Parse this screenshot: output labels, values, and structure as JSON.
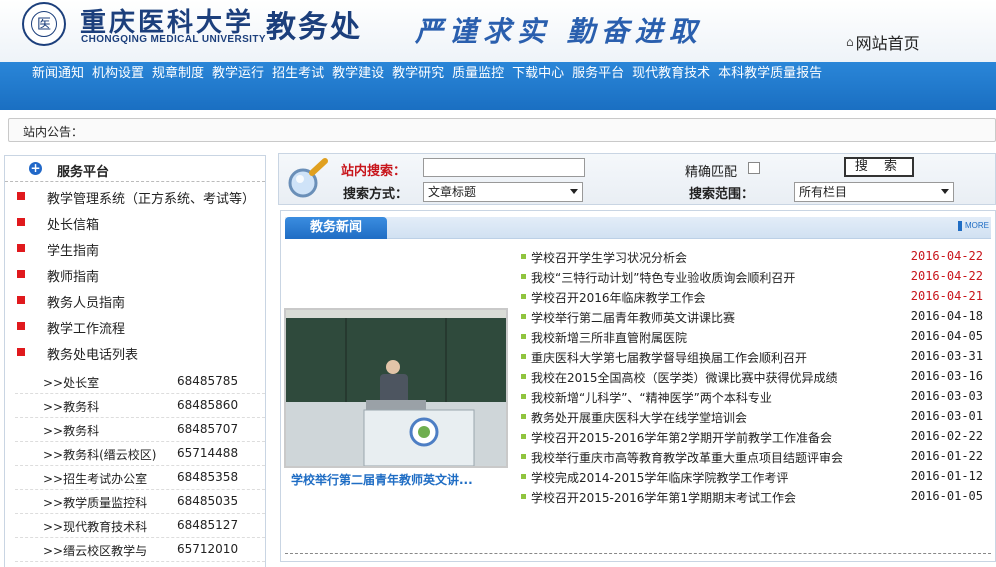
{
  "header": {
    "university_cn": "重庆医科大学",
    "university_en": "CHONGQING MEDICAL UNIVERSITY",
    "seal_glyph": "医",
    "department": "教务处",
    "motto": "严谨求实  勤奋进取",
    "home_link": "网站首页",
    "home_icon": "house-icon"
  },
  "nav": {
    "items": [
      "新闻通知",
      "机构设置",
      "规章制度",
      "教学运行",
      "招生考试",
      "教学建设",
      "教学研究",
      "质量监控",
      "下载中心",
      "服务平台",
      "现代教育技术",
      "本科教学质量报告"
    ]
  },
  "announcement": {
    "label": "站内公告："
  },
  "sidebar": {
    "title": "服务平台",
    "items": [
      "教学管理系统（正方系统、考试等）",
      "处长信箱",
      "学生指南",
      "教师指南",
      "教务人员指南",
      "教学工作流程",
      "教务处电话列表"
    ],
    "phones": [
      {
        "name": ">>处长室",
        "number": "68485785"
      },
      {
        "name": ">>教务科",
        "number": "68485860"
      },
      {
        "name": ">>教务科",
        "number": "68485707"
      },
      {
        "name": ">>教务科(缙云校区)",
        "number": "65714488"
      },
      {
        "name": ">>招生考试办公室",
        "number": "68485358"
      },
      {
        "name": ">>教学质量监控科",
        "number": "68485035"
      },
      {
        "name": ">>现代教育技术科",
        "number": "68485127"
      },
      {
        "name": ">>缙云校区教学与",
        "number": "65712010"
      }
    ]
  },
  "search": {
    "label_search": "站内搜索：",
    "input_value": "",
    "label_exact": "精确匹配",
    "button_label": "搜 索",
    "label_method": "搜索方式：",
    "method_selected": "文章标题",
    "label_range": "搜索范围：",
    "range_selected": "所有栏目"
  },
  "news": {
    "tab_label": "教务新闻",
    "more_label": "MORE",
    "photo_caption": "学校举行第二届青年教师英文讲...",
    "items": [
      {
        "title": "学校召开学生学习状况分析会",
        "date": "2016-04-22",
        "recent": true
      },
      {
        "title": "我校“三特行动计划”特色专业验收质询会顺利召开",
        "date": "2016-04-22",
        "recent": true
      },
      {
        "title": "学校召开2016年临床教学工作会",
        "date": "2016-04-21",
        "recent": true
      },
      {
        "title": "学校举行第二届青年教师英文讲课比赛",
        "date": "2016-04-18",
        "recent": false
      },
      {
        "title": "我校新增三所非直管附属医院",
        "date": "2016-04-05",
        "recent": false
      },
      {
        "title": "重庆医科大学第七届教学督导组换届工作会顺利召开",
        "date": "2016-03-31",
        "recent": false
      },
      {
        "title": "我校在2015全国高校（医学类）微课比赛中获得优异成绩",
        "date": "2016-03-16",
        "recent": false
      },
      {
        "title": "我校新增“儿科学”、“精神医学”两个本科专业",
        "date": "2016-03-03",
        "recent": false
      },
      {
        "title": "教务处开展重庆医科大学在线学堂培训会",
        "date": "2016-03-01",
        "recent": false
      },
      {
        "title": "学校召开2015-2016学年第2学期开学前教学工作准备会",
        "date": "2016-02-22",
        "recent": false
      },
      {
        "title": "我校举行重庆市高等教育教学改革重大重点项目结题评审会",
        "date": "2016-01-22",
        "recent": false
      },
      {
        "title": "学校完成2014-2015学年临床学院教学工作考评",
        "date": "2016-01-12",
        "recent": false
      },
      {
        "title": "学校召开2015-2016学年第1学期期末考试工作会",
        "date": "2016-01-05",
        "recent": false
      }
    ]
  },
  "colors": {
    "nav_bg": "#1a6fc2",
    "brand_blue": "#1c3f7c",
    "accent_red": "#c8151b",
    "bullet_green": "#8fc43f"
  }
}
